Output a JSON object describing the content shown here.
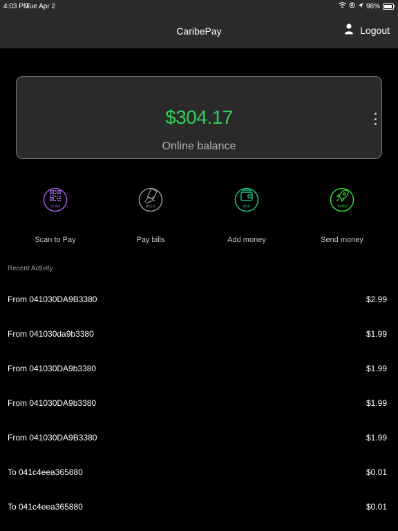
{
  "status": {
    "time": "4:03 PM",
    "date": "Tue Apr 2",
    "battery": "98%"
  },
  "nav": {
    "title": "CaribePay",
    "logout_label": "Logout"
  },
  "balance": {
    "amount": "$304.17",
    "label": "Online balance"
  },
  "actions": [
    {
      "label": "Scan to Pay",
      "badge": "SCAN",
      "icon": "qr-code-icon",
      "color": "#9b59d0"
    },
    {
      "label": "Pay bills",
      "badge": "BILLS",
      "icon": "bill-hand-icon",
      "color": "#8e8e8e"
    },
    {
      "label": "Add money",
      "badge": "ADD",
      "icon": "wallet-icon",
      "color": "#1fb889"
    },
    {
      "label": "Send money",
      "badge": "SEND",
      "icon": "rocket-icon",
      "color": "#33d033"
    }
  ],
  "recent": {
    "title": "Recent Activity",
    "items": [
      {
        "description": "From 041030DA9B3380",
        "amount": "$2.99"
      },
      {
        "description": "From 041030da9b3380",
        "amount": "$1.99"
      },
      {
        "description": "From 041030DA9b3380",
        "amount": "$1.99"
      },
      {
        "description": "From 041030DA9b3380",
        "amount": "$1.99"
      },
      {
        "description": "From 041030DA9B3380",
        "amount": "$1.99"
      },
      {
        "description": "To 041c4eea365880",
        "amount": "$0.01"
      },
      {
        "description": "To 041c4eea365880",
        "amount": "$0.01"
      }
    ]
  },
  "colors": {
    "background": "#000000",
    "bar": "#2b2b2b",
    "card": "#2a2a2a",
    "balance_green": "#30d158"
  }
}
